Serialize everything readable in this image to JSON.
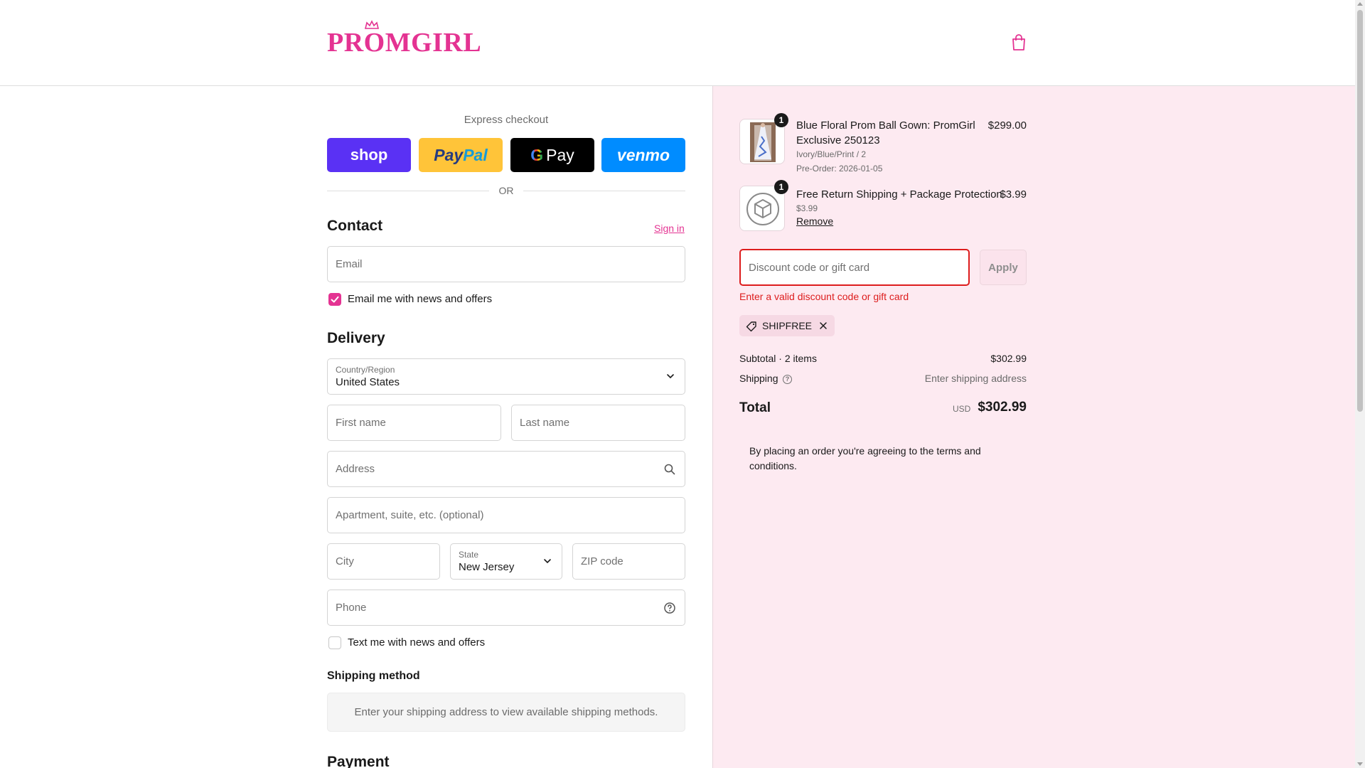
{
  "header": {
    "logo_text": "PROMGIRL",
    "cart_icon": "shopping-bag-icon"
  },
  "express": {
    "title": "Express checkout",
    "shop_label": "shop",
    "paypal_label_a": "Pay",
    "paypal_label_b": "Pal",
    "gpay_label_g": "G",
    "gpay_label": "Pay",
    "venmo_label": "venmo",
    "or_label": "OR"
  },
  "contact": {
    "title": "Contact",
    "sign_in": "Sign in",
    "email_placeholder": "Email",
    "news_label": "Email me with news and offers",
    "news_checked": true
  },
  "delivery": {
    "title": "Delivery",
    "country_label": "Country/Region",
    "country_value": "United States",
    "first_name_placeholder": "First name",
    "last_name_placeholder": "Last name",
    "address_placeholder": "Address",
    "apartment_placeholder": "Apartment, suite, etc. (optional)",
    "city_placeholder": "City",
    "state_label": "State",
    "state_value": "New Jersey",
    "zip_placeholder": "ZIP code",
    "phone_placeholder": "Phone",
    "text_label": "Text me with news and offers",
    "text_checked": false
  },
  "shipping_method": {
    "title": "Shipping method",
    "message": "Enter your shipping address to view available shipping methods."
  },
  "payment": {
    "title": "Payment"
  },
  "order": {
    "items": [
      {
        "title_line1": "Blue Floral Prom Ball Gown: PromGirl",
        "title_line2": "Exclusive 250123",
        "variant": "Ivory/Blue/Print / 2",
        "note": "Pre-Order: 2026-01-05",
        "price": "$299.00",
        "qty": "1"
      },
      {
        "title_line1": "Free Return Shipping + Package Protection",
        "variant": "$3.99",
        "remove_label": "Remove",
        "price": "$3.99",
        "qty": "1"
      }
    ],
    "discount_placeholder": "Discount code or gift card",
    "apply_label": "Apply",
    "error": "Enter a valid discount code or gift card",
    "applied_code": "SHIPFREE",
    "subtotal_label": "Subtotal · 2 items",
    "subtotal_value": "$302.99",
    "shipping_label": "Shipping",
    "shipping_value": "Enter shipping address",
    "total_label": "Total",
    "currency": "USD",
    "total_value": "$302.99",
    "terms": "By placing an order you're agreeing to the terms and conditions."
  },
  "colors": {
    "brand": "#e43392",
    "summary_bg": "#fdeaf1",
    "error": "#dd1d1d"
  }
}
